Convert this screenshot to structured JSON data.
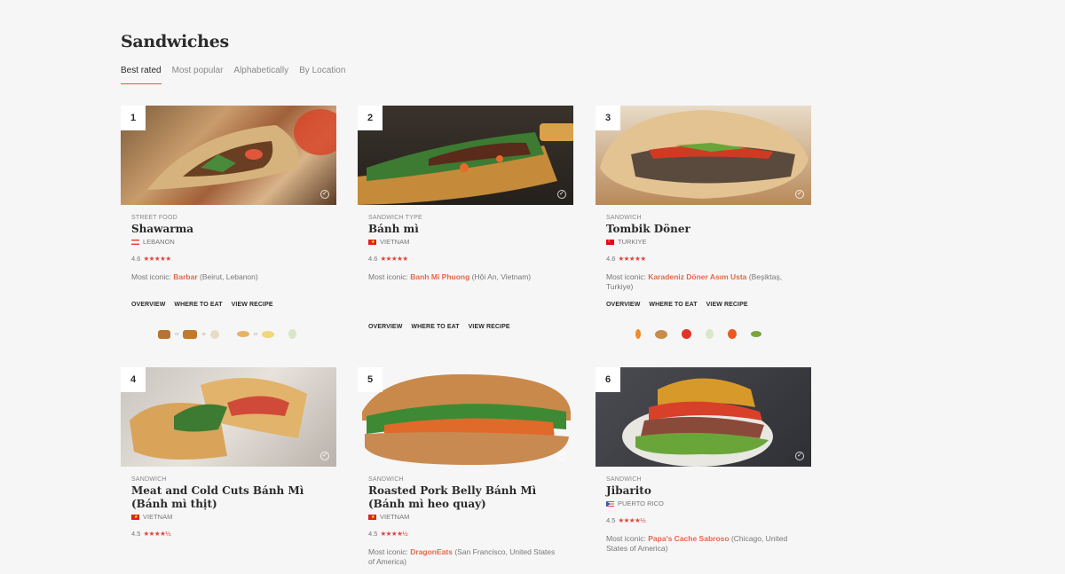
{
  "page": {
    "title": "Sandwiches"
  },
  "tabs": [
    {
      "label": "Best rated"
    },
    {
      "label": "Most popular"
    },
    {
      "label": "Alphabetically"
    },
    {
      "label": "By Location"
    }
  ],
  "cards": [
    {
      "rank": "1",
      "category": "STREET FOOD",
      "name": "Shawarma",
      "country": "LEBANON",
      "rating": "4.6",
      "stars": "★★★★★",
      "iconic_label": "Most iconic:",
      "iconic_place": "Barbar",
      "iconic_loc": "(Beirut, Lebanon)",
      "links": [
        "OVERVIEW",
        "WHERE TO EAT",
        "VIEW RECIPE"
      ],
      "ingredients": [
        "beef-icon",
        "lamb-icon",
        "chicken-icon",
        "flatbread-icon",
        "pita-icon",
        "garlic-icon"
      ],
      "ingredient_or": "or"
    },
    {
      "rank": "2",
      "category": "SANDWICH TYPE",
      "name": "Bánh mì",
      "country": "VIETNAM",
      "rating": "4.6",
      "stars": "★★★★★",
      "iconic_label": "Most iconic:",
      "iconic_place": "Banh Mi Phuong",
      "iconic_loc": "(Hội An, Vietnam)",
      "links": [
        "OVERVIEW",
        "WHERE TO EAT",
        "VIEW RECIPE"
      ]
    },
    {
      "rank": "3",
      "category": "SANDWICH",
      "name": "Tombik Döner",
      "country": "TURKIYE",
      "rating": "4.6",
      "stars": "★★★★★",
      "iconic_label": "Most iconic:",
      "iconic_place": "Karadeniz Döner Asım Usta",
      "iconic_loc": "(Beşiktaş, Turkiye)",
      "links": [
        "OVERVIEW",
        "WHERE TO EAT",
        "VIEW RECIPE"
      ],
      "ingredients": [
        "carrot-icon",
        "bread-icon",
        "tomato-icon",
        "garlic-icon",
        "pepper-icon",
        "pickle-icon"
      ]
    },
    {
      "rank": "4",
      "category": "SANDWICH",
      "name": "Meat and Cold Cuts Bánh Mì (Bánh mì thịt)",
      "country": "VIETNAM",
      "rating": "4.5",
      "stars": "★★★★½"
    },
    {
      "rank": "5",
      "category": "SANDWICH",
      "name": "Roasted Pork Belly Bánh Mì (Bánh mì heo quay)",
      "country": "VIETNAM",
      "rating": "4.5",
      "stars": "★★★★½",
      "iconic_label": "Most iconic:",
      "iconic_place": "DragonEats",
      "iconic_loc": "(San Francisco, United States of America)"
    },
    {
      "rank": "6",
      "category": "SANDWICH",
      "name": "Jibarito",
      "country": "PUERTO RICO",
      "rating": "4.5",
      "stars": "★★★★½",
      "iconic_label": "Most iconic:",
      "iconic_place": "Papa's Cache Sabroso",
      "iconic_loc": "(Chicago, United States of America)"
    }
  ],
  "colors": {
    "accent": "#e25a3a",
    "star": "#e0443a",
    "link": "#e26a4a"
  }
}
